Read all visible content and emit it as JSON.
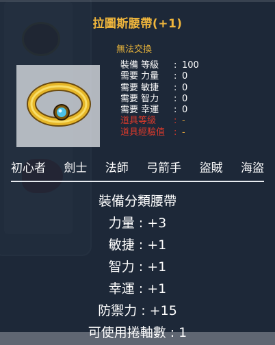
{
  "item": {
    "name": "拉圖斯腰帶(+1)",
    "untradeable": "無法交換",
    "icon": "golden-belt-with-blue-gem"
  },
  "requirements": [
    {
      "label": "裝備 等級",
      "value": "100",
      "status": "met"
    },
    {
      "label": "需要 力量",
      "value": "0",
      "status": "met"
    },
    {
      "label": "需要 敏捷",
      "value": "0",
      "status": "met"
    },
    {
      "label": "需要 智力",
      "value": "0",
      "status": "met"
    },
    {
      "label": "需要 幸運",
      "value": "0",
      "status": "met"
    },
    {
      "label": "道具等級",
      "value": "-",
      "status": "unmet"
    },
    {
      "label": "道具經驗值",
      "value": "-",
      "status": "unmet"
    }
  ],
  "jobs": [
    "初心者",
    "劍士",
    "法師",
    "弓箭手",
    "盜賊",
    "海盜"
  ],
  "effects": [
    "裝備分類腰帶",
    "力量 : +3",
    "敏捷 : +1",
    "智力 : +1",
    "幸運 : +1",
    "防禦力 : +15",
    "可使用捲軸數 : 1"
  ],
  "colors": {
    "item_name": "#f0b63c",
    "untradeable": "#e6b23a",
    "unmet_requirement": "#d83a2c",
    "tooltip_bg": "#182434"
  }
}
